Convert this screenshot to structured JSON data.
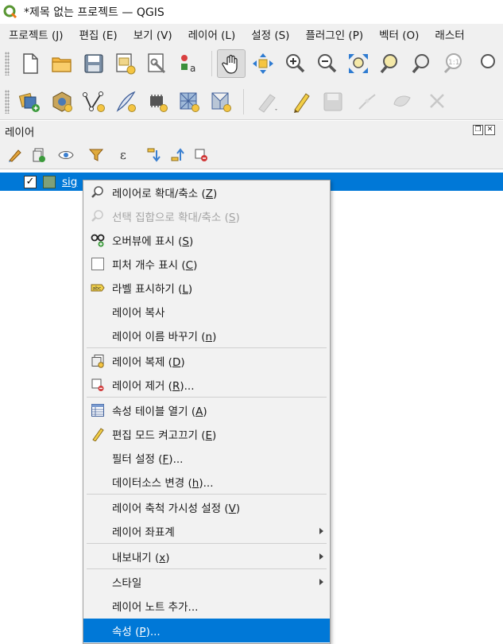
{
  "window": {
    "title": "*제목 없는 프로젝트 — QGIS"
  },
  "menubar": {
    "items": [
      "프로젝트 (J)",
      "편집 (E)",
      "보기 (V)",
      "레이어 (L)",
      "설정 (S)",
      "플러그인 (P)",
      "벡터 (O)",
      "래스터"
    ]
  },
  "toolbar1": {
    "icons": [
      "new-project-icon",
      "open-project-icon",
      "save-project-icon",
      "new-print-layout-icon",
      "layout-manager-icon",
      "style-manager-icon",
      "pan-map-icon",
      "pan-to-selection-icon",
      "zoom-in-icon",
      "zoom-out-icon",
      "zoom-full-icon",
      "zoom-to-selection-icon",
      "zoom-to-layer-icon",
      "zoom-native-resolution-icon",
      "zoom-last-icon"
    ]
  },
  "toolbar2": {
    "icons": [
      "data-source-manager-icon",
      "new-geopackage-layer-icon",
      "new-shapefile-layer-icon",
      "new-spatialite-layer-icon",
      "new-temporary-scratch-layer-icon",
      "new-virtual-layer-icon",
      "new-mesh-layer-icon",
      "current-edits-icon",
      "toggle-editing-icon",
      "save-layer-edits-icon",
      "digitize-icon",
      "vertex-tool-icon",
      "delete-selected-icon"
    ]
  },
  "layers_panel": {
    "title": "레이어",
    "tools": [
      "open-layer-styling-icon",
      "add-group-icon",
      "manage-map-themes-icon",
      "filter-legend-icon",
      "filter-by-expression-icon",
      "expand-all-icon",
      "collapse-all-icon",
      "remove-layer-icon"
    ],
    "layers": [
      {
        "name": "sig",
        "checked": true,
        "color": "#7fa079"
      }
    ]
  },
  "context_menu": {
    "items": [
      {
        "pre": "레이어로 확대/축소 (",
        "key": "Z",
        "post": ")",
        "icon": "zoom-to-layer-icon",
        "disabled": false
      },
      {
        "pre": "선택 집합으로 확대/축소 (",
        "key": "S",
        "post": ")",
        "icon": "zoom-to-selection-icon",
        "disabled": true
      },
      {
        "pre": "오버뷰에 표시 (",
        "key": "S",
        "post": ")",
        "icon": "show-in-overview-icon",
        "disabled": false
      },
      {
        "pre": "피처 개수 표시 (",
        "key": "C",
        "post": ")",
        "icon": "feature-count-checkbox-icon",
        "disabled": false
      },
      {
        "pre": "라벨 표시하기 (",
        "key": "L",
        "post": ")",
        "icon": "show-labels-icon",
        "disabled": false
      },
      {
        "pre": "레이어 복사",
        "key": "",
        "post": "",
        "icon": "",
        "disabled": false
      },
      {
        "pre": "레이어 이름 바꾸기 (",
        "key": "n",
        "post": ")",
        "icon": "",
        "disabled": false
      },
      {
        "pre": "레이어 복제 (",
        "key": "D",
        "post": ")",
        "icon": "duplicate-layer-icon",
        "disabled": false
      },
      {
        "pre": "레이어 제거 (",
        "key": "R",
        "post": ")...",
        "icon": "remove-layer-icon",
        "disabled": false
      },
      {
        "pre": "속성 테이블 열기 (",
        "key": "A",
        "post": ")",
        "icon": "attribute-table-icon",
        "disabled": false
      },
      {
        "pre": "편집 모드 켜고끄기 (",
        "key": "E",
        "post": ")",
        "icon": "toggle-editing-icon",
        "disabled": false
      },
      {
        "pre": "필터 설정 (",
        "key": "F",
        "post": ")...",
        "icon": "",
        "disabled": false
      },
      {
        "pre": "데이터소스 변경 (",
        "key": "h",
        "post": ")...",
        "icon": "",
        "disabled": false
      },
      {
        "pre": "레이어 축척 가시성 설정 (",
        "key": "V",
        "post": ")",
        "icon": "",
        "disabled": false
      },
      {
        "pre": "레이어 좌표계",
        "key": "",
        "post": "",
        "icon": "",
        "disabled": false,
        "submenu": true
      },
      {
        "pre": "내보내기 (",
        "key": "x",
        "post": ")",
        "icon": "",
        "disabled": false,
        "submenu": true
      },
      {
        "pre": "스타일",
        "key": "",
        "post": "",
        "icon": "",
        "disabled": false,
        "submenu": true
      },
      {
        "pre": "레이어 노트 추가...",
        "key": "",
        "post": "",
        "icon": "",
        "disabled": false
      },
      {
        "pre": "속성 (",
        "key": "P",
        "post": ")...",
        "icon": "",
        "disabled": false,
        "selected": true
      }
    ]
  },
  "colors": {
    "selection": "#0078d7",
    "menu_bg": "#f2f2f2",
    "toolbar_bg": "#f0f0f0"
  }
}
